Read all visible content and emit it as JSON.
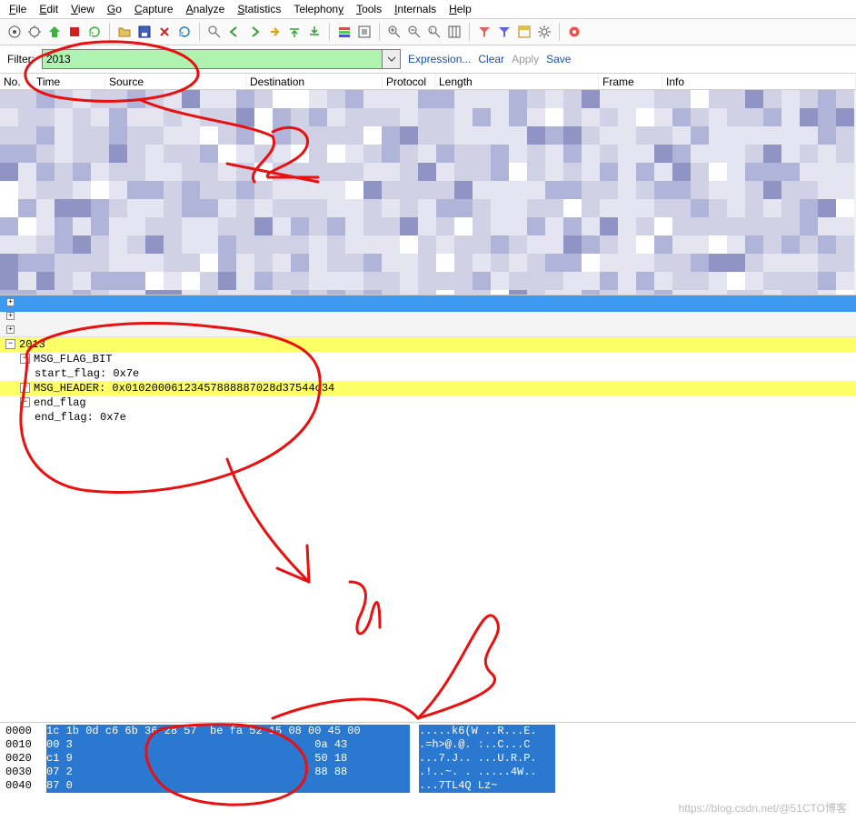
{
  "menu": {
    "file": "File",
    "edit": "Edit",
    "view": "View",
    "go": "Go",
    "capture": "Capture",
    "analyze": "Analyze",
    "statistics": "Statistics",
    "telephony": "Telephony",
    "tools": "Tools",
    "internals": "Internals",
    "help": "Help"
  },
  "toolbar_icons": [
    "interfaces-icon",
    "options-icon",
    "start-capture-icon",
    "stop-capture-icon",
    "restart-capture-icon",
    "open-icon",
    "save-icon",
    "close-icon",
    "reload-icon",
    "",
    "find-icon",
    "go-back-icon",
    "go-forward-icon",
    "jump-icon",
    "go-top-icon",
    "go-bottom-icon",
    "",
    "colorize-icon",
    "auto-scroll-icon",
    "",
    "zoom-in-icon",
    "zoom-out-icon",
    "zoom-reset-icon",
    "resize-cols-icon",
    "",
    "capture-filters-icon",
    "display-filters-icon",
    "coloring-rules-icon",
    "prefs-icon",
    "",
    "help-icon"
  ],
  "filter": {
    "label": "Filter:",
    "value": "2013",
    "expression": "Expression...",
    "clear": "Clear",
    "apply": "Apply",
    "save": "Save"
  },
  "columns": {
    "no": "No.",
    "time": "Time",
    "source": "Source",
    "destination": "Destination",
    "protocol": "Protocol",
    "length": "Length",
    "frame": "Frame",
    "info": "Info"
  },
  "tree": {
    "root": "2013",
    "msg_flag_bit": "MSG_FLAG_BIT",
    "start_flag": "start_flag: 0x7e",
    "msg_header": "MSG_HEADER: 0x01020006123457888887028d37544c34",
    "end_flag": "end_flag",
    "end_flag_value": "end_flag: 0x7e"
  },
  "hex": {
    "rows": [
      {
        "off": "0000",
        "bytes": "1c 1b 0d c6 6b 36 28 57  be fa 52 15 08 00 45 00",
        "ascii": ".....k6(W ..R...E."
      },
      {
        "off": "0010",
        "bytes": "00 3                                     0a 43",
        "ascii": ".=h>@.@. :..C...C"
      },
      {
        "off": "0020",
        "bytes": "c1 9                                     50 18",
        "ascii": "...7.J.. ...U.R.P."
      },
      {
        "off": "0030",
        "bytes": "07 2                                     88 88",
        "ascii": ".!..~. . .....4W.."
      },
      {
        "off": "0040",
        "bytes": "87 0                                          ",
        "ascii": "...7TL4Q Lz~"
      }
    ]
  },
  "watermark": "https://blog.csdn.net/@51CTO博客"
}
